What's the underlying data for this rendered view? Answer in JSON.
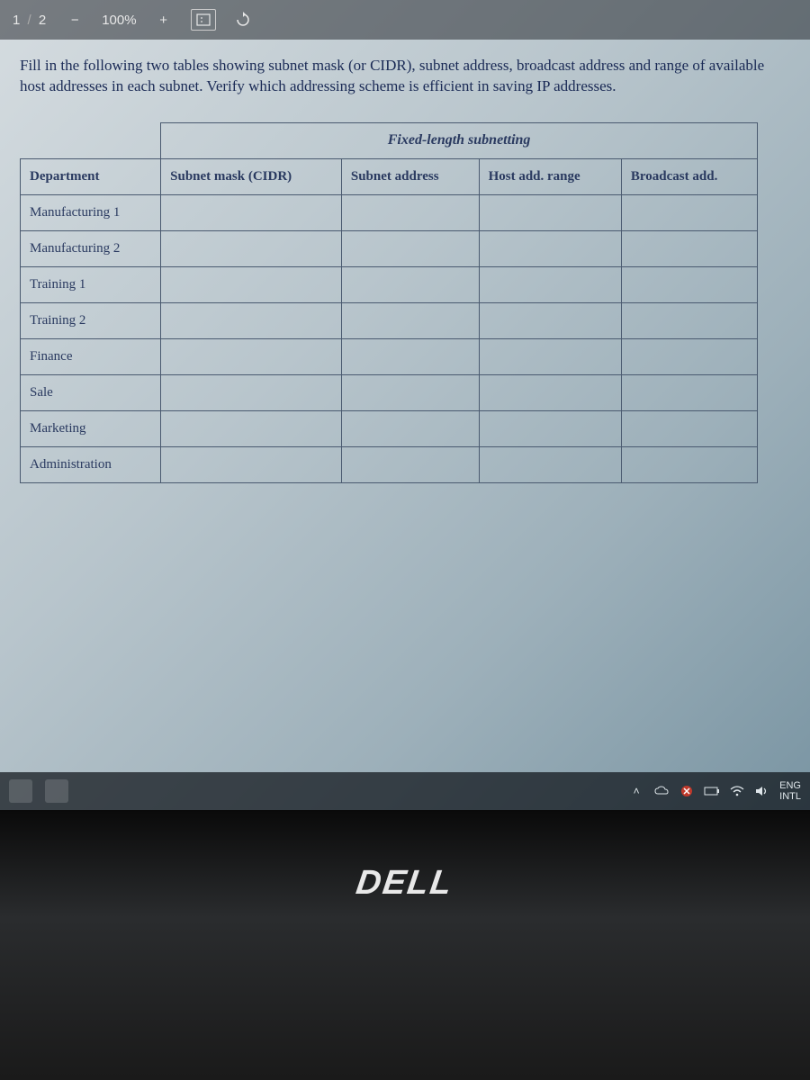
{
  "toolbar": {
    "page_current": "1",
    "page_sep": "/",
    "page_total": "2",
    "zoom_minus": "−",
    "zoom_pct": "100%",
    "zoom_plus": "+"
  },
  "document": {
    "instruction": "Fill in the following two tables showing subnet mask (or CIDR), subnet address, broadcast address and range of available host addresses in each subnet. Verify which addressing scheme is efficient in saving IP addresses.",
    "table": {
      "title": "Fixed-length subnetting",
      "headers": {
        "dept": "Department",
        "mask": "Subnet mask (CIDR)",
        "addr": "Subnet address",
        "hostrange": "Host add. range",
        "broadcast": "Broadcast add."
      },
      "rows": [
        {
          "dept": "Manufacturing 1",
          "mask": "",
          "addr": "",
          "hostrange": "",
          "broadcast": ""
        },
        {
          "dept": "Manufacturing 2",
          "mask": "",
          "addr": "",
          "hostrange": "",
          "broadcast": ""
        },
        {
          "dept": "Training 1",
          "mask": "",
          "addr": "",
          "hostrange": "",
          "broadcast": ""
        },
        {
          "dept": "Training 2",
          "mask": "",
          "addr": "",
          "hostrange": "",
          "broadcast": ""
        },
        {
          "dept": "Finance",
          "mask": "",
          "addr": "",
          "hostrange": "",
          "broadcast": ""
        },
        {
          "dept": "Sale",
          "mask": "",
          "addr": "",
          "hostrange": "",
          "broadcast": ""
        },
        {
          "dept": "Marketing",
          "mask": "",
          "addr": "",
          "hostrange": "",
          "broadcast": ""
        },
        {
          "dept": "Administration",
          "mask": "",
          "addr": "",
          "hostrange": "",
          "broadcast": ""
        }
      ]
    }
  },
  "taskbar": {
    "lang_top": "ENG",
    "lang_bottom": "INTL",
    "chevron": "˄"
  },
  "bezel": {
    "brand": "DELL"
  }
}
